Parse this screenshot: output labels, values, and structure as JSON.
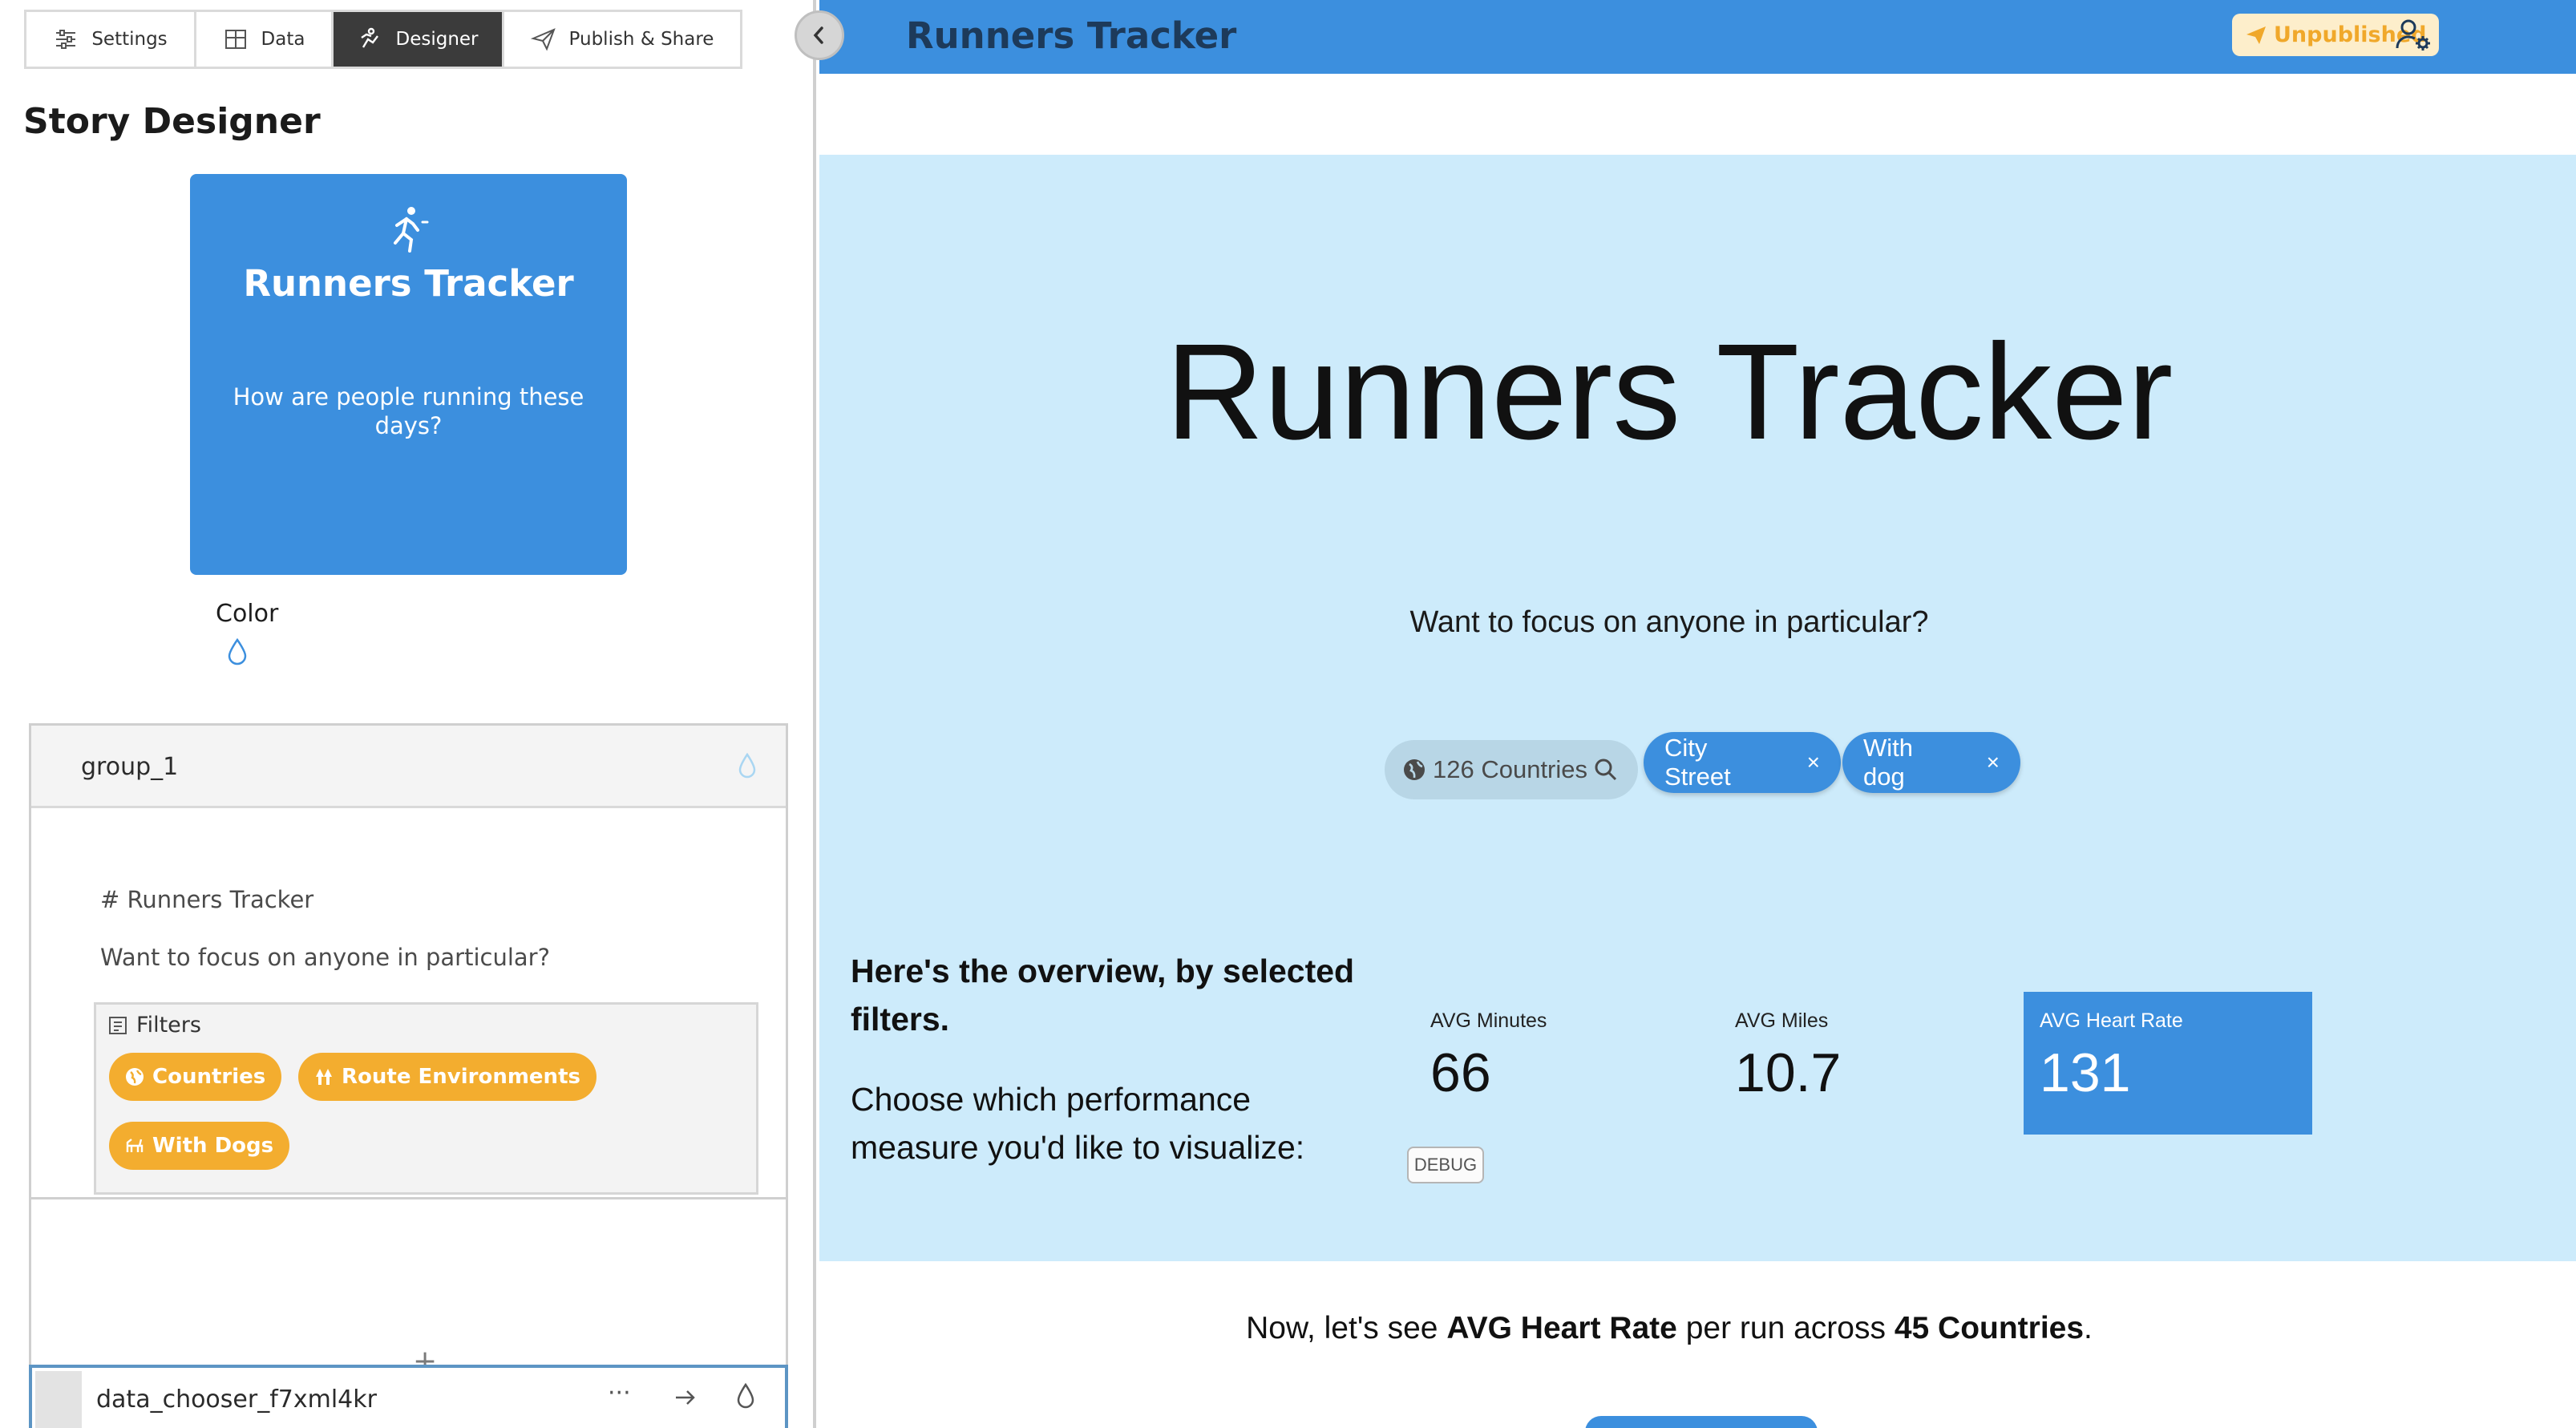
{
  "left": {
    "tabs": [
      {
        "label": "Settings",
        "icon": "sliders-icon"
      },
      {
        "label": "Data",
        "icon": "table-icon"
      },
      {
        "label": "Designer",
        "icon": "designer-icon",
        "active": true
      },
      {
        "label": "Publish & Share",
        "icon": "send-icon"
      }
    ],
    "panel_title": "Story Designer",
    "cover": {
      "icon": "runner-icon",
      "title": "Runners Tracker",
      "subtitle": "How are people running these days?",
      "color": "#3c8fde"
    },
    "color_label": "Color",
    "group": {
      "name": "group_1",
      "markdown_line1": "# Runners Tracker",
      "markdown_line2": "Want to focus on anyone in particular?",
      "filters_label": "Filters",
      "filters": [
        {
          "label": "Countries",
          "icon": "globe-icon"
        },
        {
          "label": "Route Environments",
          "icon": "trees-icon"
        },
        {
          "label": "With Dogs",
          "icon": "dog-icon"
        }
      ],
      "filter_color": "#f3ad2f"
    },
    "add_symbol": "+",
    "chooser": {
      "name": "data_chooser_f7xml4kr",
      "more": "···"
    }
  },
  "preview": {
    "app_title": "Runners Tracker",
    "status": "Unpublished",
    "hero_title": "Runners Tracker",
    "hero_subtitle": "Want to focus on anyone in particular?",
    "country_filter": "126 Countries",
    "selected_chips": [
      {
        "label": "City Street",
        "close": "×"
      },
      {
        "label": "With dog",
        "close": "×"
      }
    ],
    "overview_heading": "Here's the overview, by selected filters.",
    "overview_instruction": "Choose which performance measure you'd like to visualize:",
    "metrics": [
      {
        "label": "AVG Minutes",
        "value": "66"
      },
      {
        "label": "AVG Miles",
        "value": "10.7"
      },
      {
        "label": "AVG Heart Rate",
        "value": "131",
        "selected": true
      }
    ],
    "debug_label": "DEBUG",
    "summary": {
      "prefix": "Now, let's see ",
      "metric": "AVG Heart Rate",
      "middle": " per run across ",
      "scope": "45 Countries",
      "suffix": "."
    },
    "colors": {
      "topbar": "#3c8fde",
      "hero_bg": "#cdebfb",
      "badge_bg": "#fdeecb",
      "badge_text": "#f0a82a"
    }
  }
}
